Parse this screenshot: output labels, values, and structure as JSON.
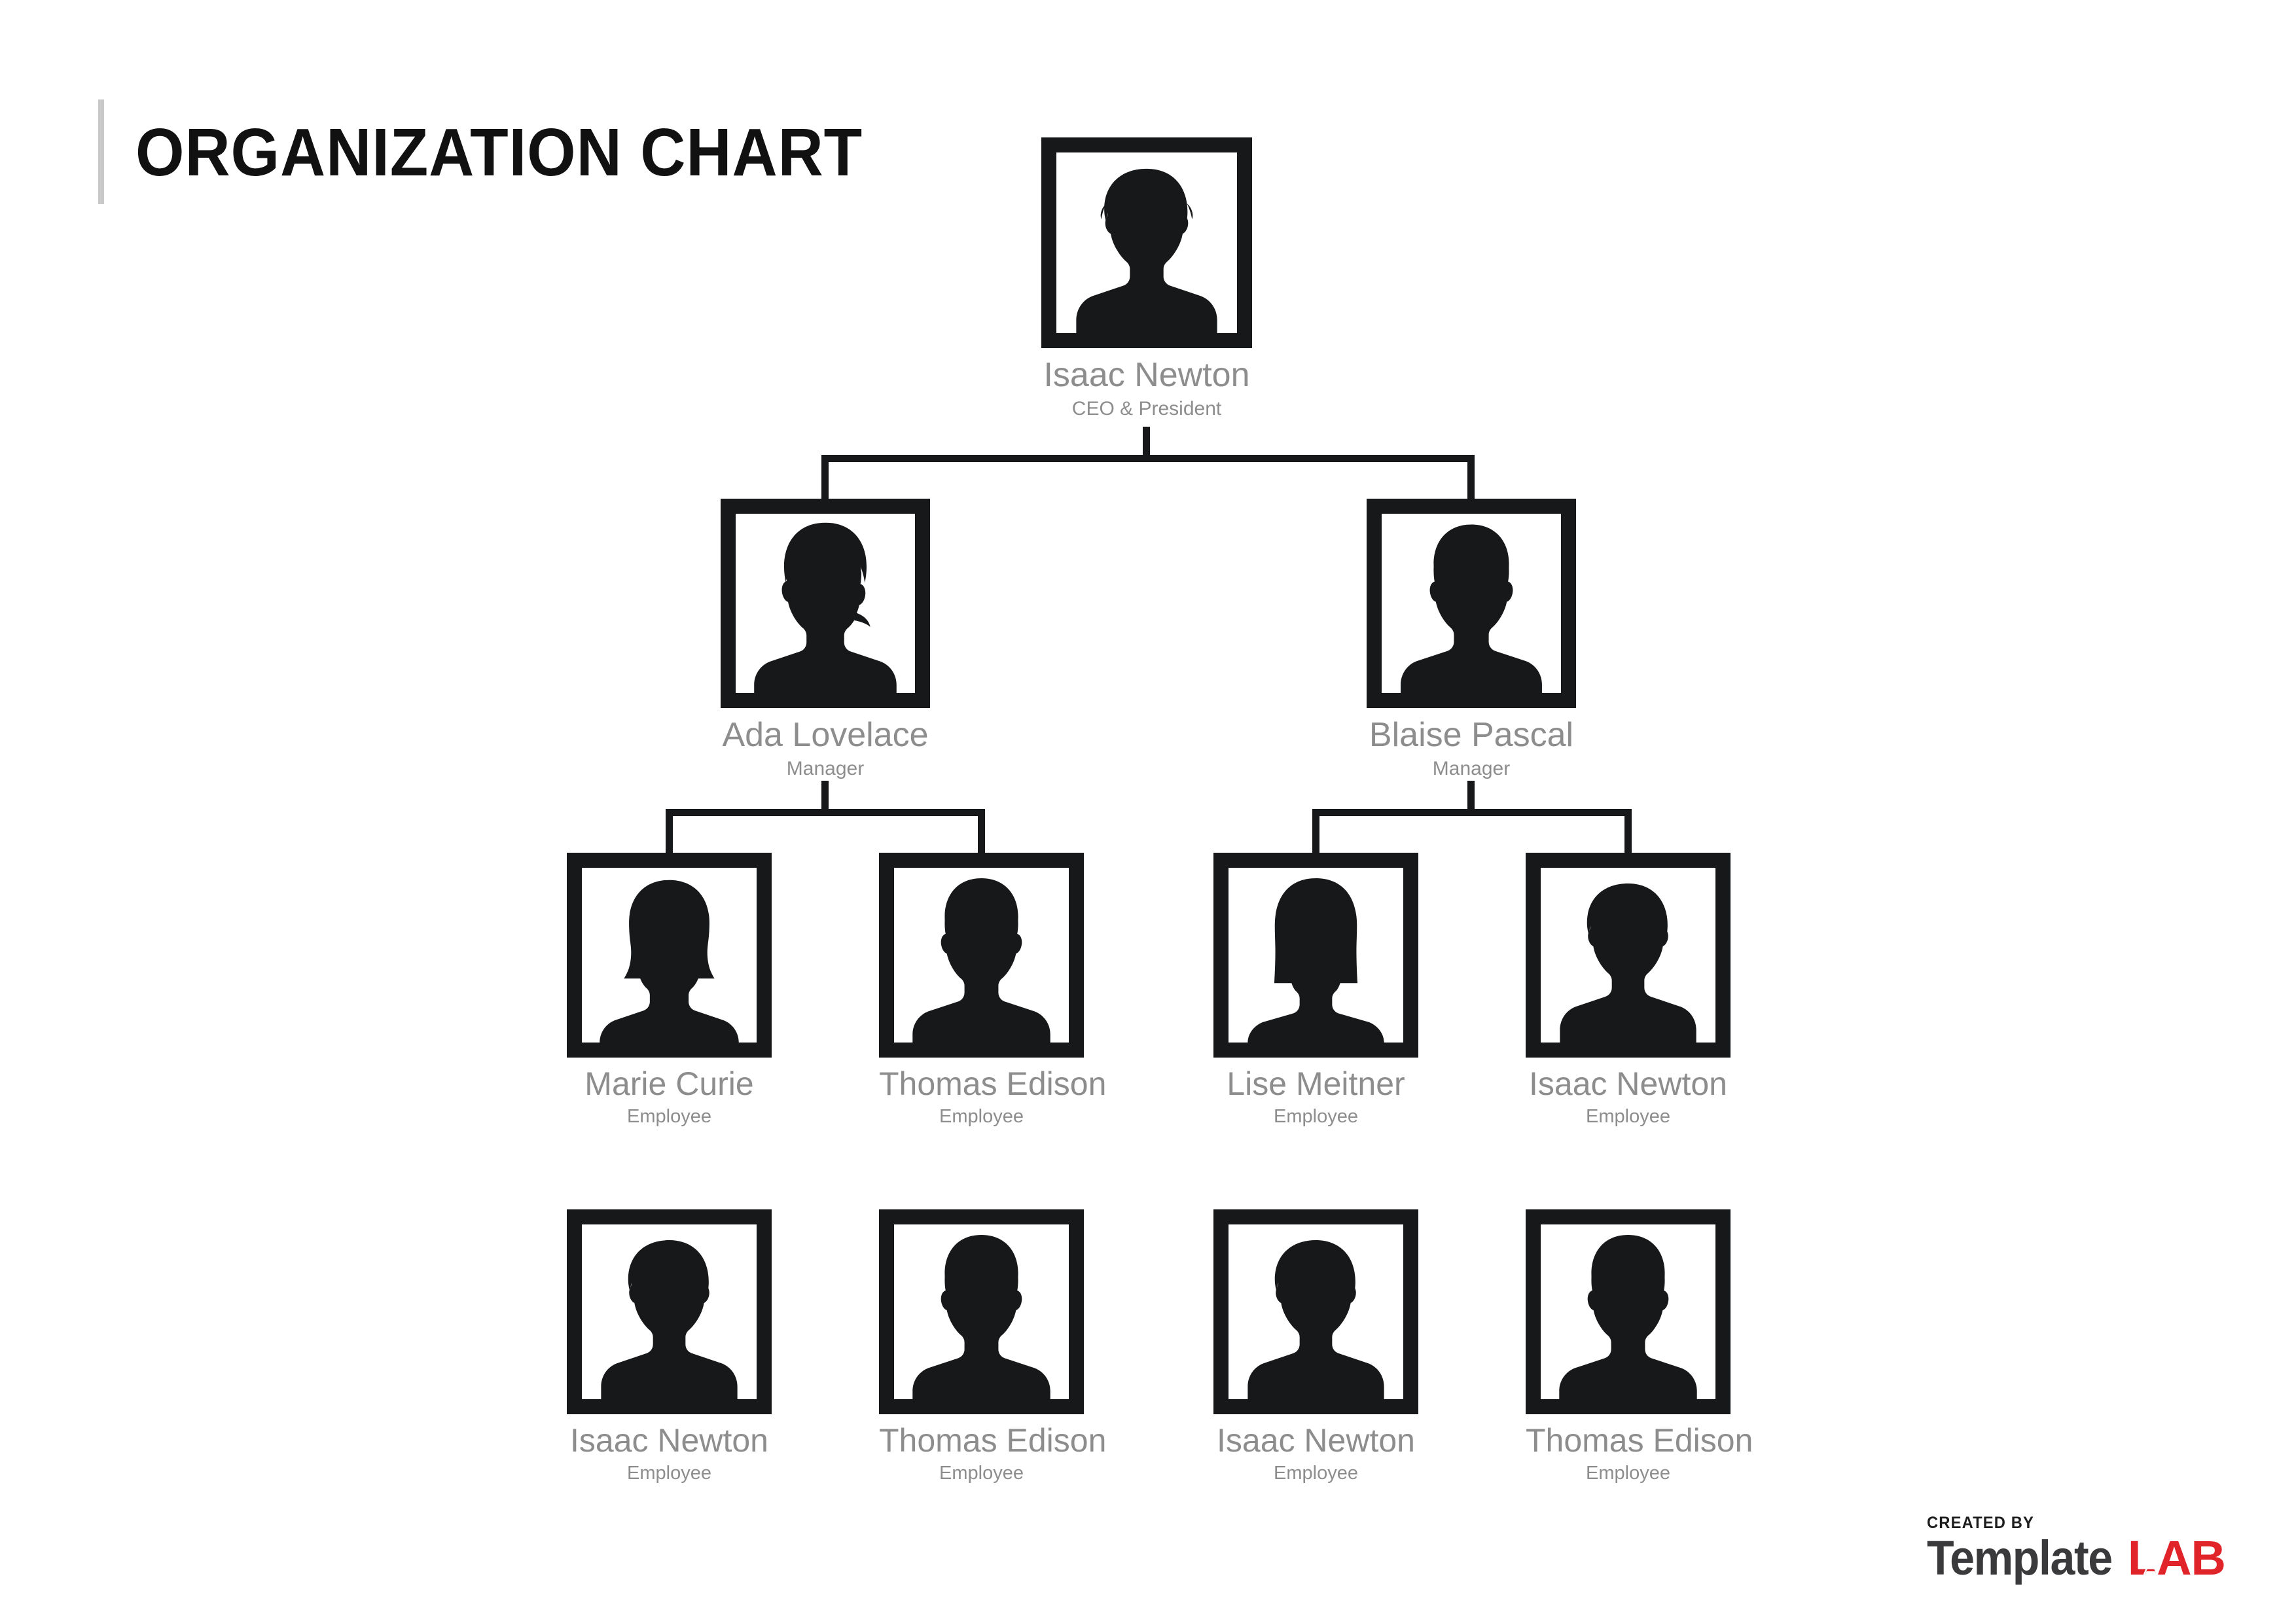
{
  "page": {
    "title": "ORGANIZATION CHART",
    "background_color": "#ffffff",
    "title_color": "#111111",
    "title_rule_color": "#c9c9c9",
    "name_color": "#8d8d8d",
    "role_color": "#8d8d8d",
    "frame_color": "#17181a",
    "connector_color": "#17181a"
  },
  "chart_data": {
    "type": "diagram",
    "diagram_kind": "organization-chart",
    "title": "ORGANIZATION CHART",
    "levels": [
      {
        "level": 1,
        "role_group": "executive",
        "nodes": [
          {
            "id": "n1",
            "name": "Isaac Newton",
            "role": "CEO & President",
            "avatar": "male-curly-hair-silhouette-icon"
          }
        ]
      },
      {
        "level": 2,
        "role_group": "management",
        "nodes": [
          {
            "id": "n2",
            "name": "Ada Lovelace",
            "role": "Manager",
            "avatar": "female-ponytail-silhouette-icon",
            "parent": "n1"
          },
          {
            "id": "n3",
            "name": "Blaise Pascal",
            "role": "Manager",
            "avatar": "male-short-hair-silhouette-icon",
            "parent": "n1"
          }
        ]
      },
      {
        "level": 3,
        "role_group": "staff",
        "nodes": [
          {
            "id": "n4",
            "name": "Marie Curie",
            "role": "Employee",
            "avatar": "female-bob-hair-silhouette-icon",
            "parent": "n2"
          },
          {
            "id": "n5",
            "name": "Thomas Edison",
            "role": "Employee",
            "avatar": "male-short-hair-silhouette-icon",
            "parent": "n2"
          },
          {
            "id": "n6",
            "name": "Lise Meitner",
            "role": "Employee",
            "avatar": "female-long-hair-silhouette-icon",
            "parent": "n3"
          },
          {
            "id": "n7",
            "name": "Isaac Newton",
            "role": "Employee",
            "avatar": "male-curly-hair-silhouette-icon",
            "parent": "n3"
          }
        ]
      },
      {
        "level": 4,
        "role_group": "staff",
        "nodes": [
          {
            "id": "n8",
            "name": "Isaac Newton",
            "role": "Employee",
            "avatar": "male-curly-hair-silhouette-icon",
            "parent": null
          },
          {
            "id": "n9",
            "name": "Thomas Edison",
            "role": "Employee",
            "avatar": "male-short-hair-silhouette-icon",
            "parent": null
          },
          {
            "id": "n10",
            "name": "Isaac Newton",
            "role": "Employee",
            "avatar": "male-curly-hair-silhouette-icon",
            "parent": null
          },
          {
            "id": "n11",
            "name": "Thomas Edison",
            "role": "Employee",
            "avatar": "male-short-hair-silhouette-icon",
            "parent": null
          }
        ]
      }
    ],
    "edges": [
      {
        "from": "n1",
        "to": "n2"
      },
      {
        "from": "n1",
        "to": "n3"
      },
      {
        "from": "n2",
        "to": "n4"
      },
      {
        "from": "n2",
        "to": "n5"
      },
      {
        "from": "n3",
        "to": "n6"
      },
      {
        "from": "n3",
        "to": "n7"
      }
    ]
  },
  "nodes": {
    "ceo": {
      "name": "Isaac Newton",
      "role": "CEO & President"
    },
    "mgr1": {
      "name": "Ada Lovelace",
      "role": "Manager"
    },
    "mgr2": {
      "name": "Blaise Pascal",
      "role": "Manager"
    },
    "emp1": {
      "name": "Marie Curie",
      "role": "Employee"
    },
    "emp2": {
      "name": "Thomas Edison",
      "role": "Employee"
    },
    "emp3": {
      "name": "Lise Meitner",
      "role": "Employee"
    },
    "emp4": {
      "name": "Isaac Newton",
      "role": "Employee"
    },
    "emp5": {
      "name": "Isaac Newton",
      "role": "Employee"
    },
    "emp6": {
      "name": "Thomas Edison",
      "role": "Employee"
    },
    "emp7": {
      "name": "Isaac Newton",
      "role": "Employee"
    },
    "emp8": {
      "name": "Thomas Edison",
      "role": "Employee"
    }
  },
  "footer": {
    "created_by": "CREATED BY",
    "brand_first": "Template",
    "brand_second": "LAB",
    "brand_second_color": "#e0242a",
    "brand_first_color": "#3a3a3c"
  }
}
